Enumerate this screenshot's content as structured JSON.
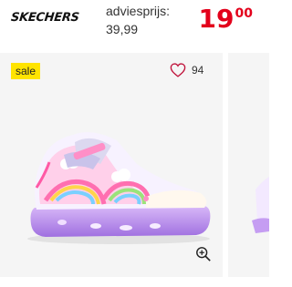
{
  "header": {
    "brand": "SKECHERS",
    "advies_label": "adviesprijs:",
    "advies_value": "39,99",
    "price_main": "19",
    "price_cents": "00"
  },
  "card": {
    "badge": "sale",
    "favorites_count": "94"
  },
  "colors": {
    "price": "#e3001b",
    "badge_bg": "#ffe400",
    "card_bg": "#f5f5f5",
    "sole_glow": "#c89cf0"
  },
  "icons": [
    "heart-icon",
    "zoom-icon"
  ]
}
